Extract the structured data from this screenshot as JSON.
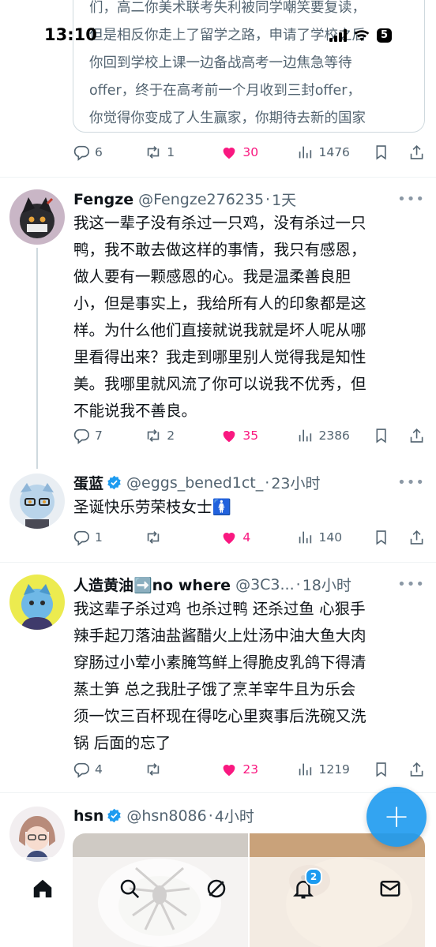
{
  "status_bar": {
    "time": "13:10",
    "battery": "5"
  },
  "quoted_card": {
    "lines": [
      "们，高二你美术联考失利被同学嘲笑要复读，",
      "但是相反你走上了留学之路，申请了学校之后",
      "你回到学校上课一边备战高考一边焦急等待",
      "offer，终于在高考前一个月收到三封offer，",
      "你觉得你变成了人生赢家，你期待去新的国家"
    ]
  },
  "quoted_actions": {
    "replies": "6",
    "reposts": "1",
    "likes": "30",
    "views": "1476"
  },
  "tweets": [
    {
      "name": "Fengze",
      "handle": "@Fengze276235",
      "sep": "·",
      "time": "1天",
      "more": "•••",
      "body": [
        "我这一辈子没有杀过一只鸡，没有杀过一只",
        "鸭，我不敢去做这样的事情，我只有感恩，",
        "做人要有一颗感恩的心。我是温柔善良胆",
        "小，但是事实上，我给所有人的印象都是这",
        "样。为什么他们直接就说我就是坏人呢从哪",
        "里看得出来？我走到哪里别人觉得我是知性",
        "美。我哪里就风流了你可以说我不优秀，但",
        "不能说我不善良。"
      ],
      "actions": {
        "replies": "7",
        "reposts": "2",
        "likes": "35",
        "views": "2386"
      }
    },
    {
      "name": "蛋蓝",
      "handle": "@eggs_bened1ct_",
      "sep": "·",
      "time": "23小时",
      "more": "•••",
      "body": [
        "圣诞快乐劳荣枝女士🚺"
      ],
      "actions": {
        "replies": "1",
        "reposts": "",
        "likes": "4",
        "views": "140"
      }
    },
    {
      "name": "人造黄油➡️no where",
      "handle": "@3C3...",
      "sep": "·",
      "time": "18小时",
      "more": "•••",
      "body": [
        "我这辈子杀过鸡 也杀过鸭 还杀过鱼 心狠手",
        "辣手起刀落油盐酱醋火上灶汤中油大鱼大肉",
        "穿肠过小荤小素腌笃鲜上得脆皮乳鸽下得清",
        "蒸土笋 总之我肚子饿了烹羊宰牛且为乐会",
        "须一饮三百杯现在得吃心里爽事后洗碗又洗",
        "锅 后面的忘了"
      ],
      "actions": {
        "replies": "4",
        "reposts": "",
        "likes": "23",
        "views": "1219"
      }
    },
    {
      "name": "hsn",
      "handle": "@hsn8086",
      "sep": "·",
      "time": "4小时",
      "more": "•••"
    }
  ],
  "fab": {
    "label": "+"
  },
  "bottom_nav": {
    "notifications_badge": "2"
  },
  "colors": {
    "accent": "#1d9bf0",
    "like": "#f91880",
    "secondary_text": "#536471"
  }
}
